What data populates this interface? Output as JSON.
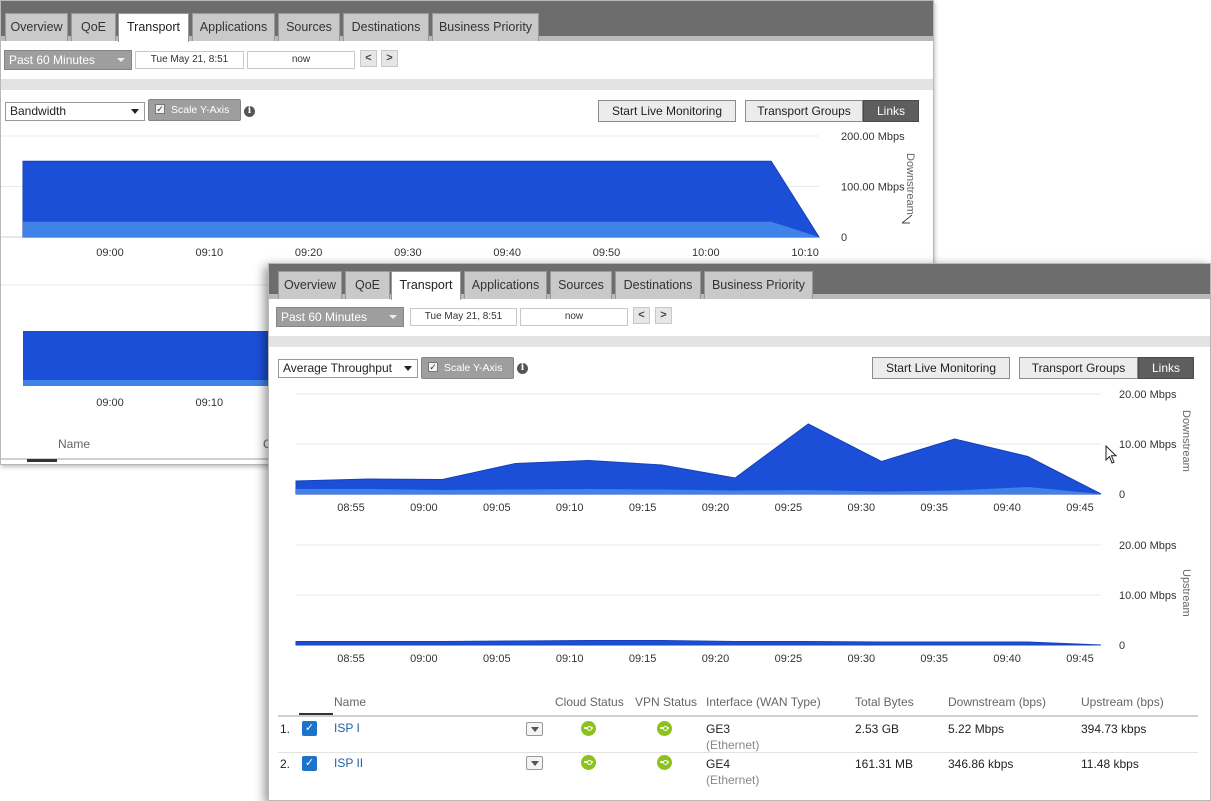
{
  "tabs": [
    "Overview",
    "QoE",
    "Transport",
    "Applications",
    "Sources",
    "Destinations",
    "Business Priority"
  ],
  "active_tab": "Transport",
  "time_range": {
    "preset": "Past 60 Minutes",
    "start": "Tue May 21, 8:51",
    "end": "now",
    "prev": "<",
    "next": ">"
  },
  "controls": {
    "scale_y_axis": "Scale Y-Axis",
    "scale_checked": true,
    "start_live": "Start Live Monitoring",
    "transport_groups": "Transport Groups",
    "links": "Links",
    "info": "i"
  },
  "back_panel": {
    "metric": "Bandwidth",
    "downstream_label": "Downstream",
    "chart_data": {
      "type": "area",
      "x": [
        "09:00",
        "09:10",
        "09:20",
        "09:30",
        "09:40",
        "09:50",
        "10:00",
        "10:10"
      ],
      "y_ticks": [
        "200.00 Mbps",
        "100.00 Mbps",
        "0"
      ],
      "ylim": [
        0,
        200
      ],
      "unit": "Mbps",
      "series": [
        {
          "color": "#1b4fd8",
          "points": [
            [
              0,
              150
            ],
            [
              0.94,
              150
            ],
            [
              1,
              0
            ]
          ]
        },
        {
          "color": "#3f82e8",
          "points": [
            [
              0,
              30
            ],
            [
              0.94,
              30
            ],
            [
              1,
              0
            ]
          ]
        }
      ]
    },
    "lower_x": [
      "09:00",
      "09:10"
    ],
    "table_name_header": "Name",
    "table_partial_header": "C"
  },
  "front_panel": {
    "metric": "Average Throughput",
    "downstream_label": "Downstream",
    "upstream_label": "Upstream",
    "chart_data": [
      {
        "type": "area",
        "title": "Downstream",
        "x": [
          "08:55",
          "09:00",
          "09:05",
          "09:10",
          "09:15",
          "09:20",
          "09:25",
          "09:30",
          "09:35",
          "09:40",
          "09:45"
        ],
        "y_ticks": [
          "20.00 Mbps",
          "10.00 Mbps",
          "0"
        ],
        "ylim": [
          0,
          20
        ],
        "unit": "Mbps",
        "series": [
          {
            "color": "#1b4fd8",
            "values": [
              2.6,
              3.0,
              2.9,
              6.1,
              6.7,
              5.8,
              3.2,
              14.0,
              6.5,
              11.0,
              7.5,
              0
            ]
          },
          {
            "color": "#3f82e8",
            "values": [
              1.0,
              1.0,
              0.8,
              0.9,
              1.0,
              0.9,
              0.7,
              0.8,
              0.5,
              0.7,
              1.4,
              0
            ]
          }
        ]
      },
      {
        "type": "area",
        "title": "Upstream",
        "x": [
          "08:55",
          "09:00",
          "09:05",
          "09:10",
          "09:15",
          "09:20",
          "09:25",
          "09:30",
          "09:35",
          "09:40",
          "09:45"
        ],
        "y_ticks": [
          "20.00 Mbps",
          "10.00 Mbps",
          "0"
        ],
        "ylim": [
          0,
          20
        ],
        "unit": "Mbps",
        "series": [
          {
            "color": "#1b4fd8",
            "values": [
              0.7,
              0.7,
              0.7,
              0.8,
              0.9,
              0.9,
              0.7,
              0.7,
              0.6,
              0.6,
              0.6,
              0
            ]
          }
        ]
      }
    ],
    "table": {
      "headers": [
        "Name",
        "Cloud Status",
        "VPN Status",
        "Interface (WAN Type)",
        "Total Bytes",
        "Downstream (bps)",
        "Upstream (bps)"
      ],
      "rows": [
        {
          "index": "1.",
          "name": "ISP I",
          "interface": "GE3",
          "wan_type": "(Ethernet)",
          "total_bytes": "2.53 GB",
          "downstream": "5.22 Mbps",
          "upstream": "394.73 kbps"
        },
        {
          "index": "2.",
          "name": "ISP II",
          "interface": "GE4",
          "wan_type": "(Ethernet)",
          "total_bytes": "161.31 MB",
          "downstream": "346.86 kbps",
          "upstream": "11.48 kbps"
        }
      ]
    }
  }
}
